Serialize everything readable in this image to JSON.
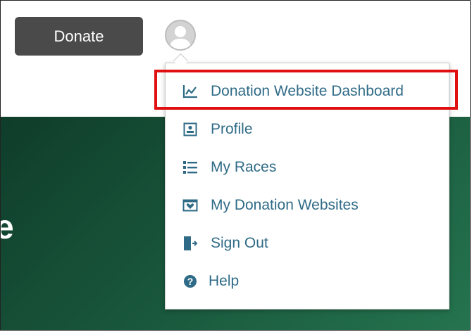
{
  "header": {
    "donate_label": "Donate"
  },
  "hero": {
    "text": "e"
  },
  "menu": {
    "items": [
      {
        "label": "Donation Website Dashboard",
        "icon": "chart-line-icon"
      },
      {
        "label": "Profile",
        "icon": "profile-card-icon"
      },
      {
        "label": "My Races",
        "icon": "list-icon"
      },
      {
        "label": "My Donation Websites",
        "icon": "heart-envelope-icon"
      },
      {
        "label": "Sign Out",
        "icon": "door-exit-icon"
      },
      {
        "label": "Help",
        "icon": "question-circle-icon"
      }
    ],
    "highlighted_item": "Donation Website Dashboard"
  },
  "colors": {
    "link": "#2f6b87",
    "button": "#4a4a4a",
    "hero_dark": "#0f3d2a",
    "hero_light": "#25744f",
    "highlight": "#e01010"
  }
}
